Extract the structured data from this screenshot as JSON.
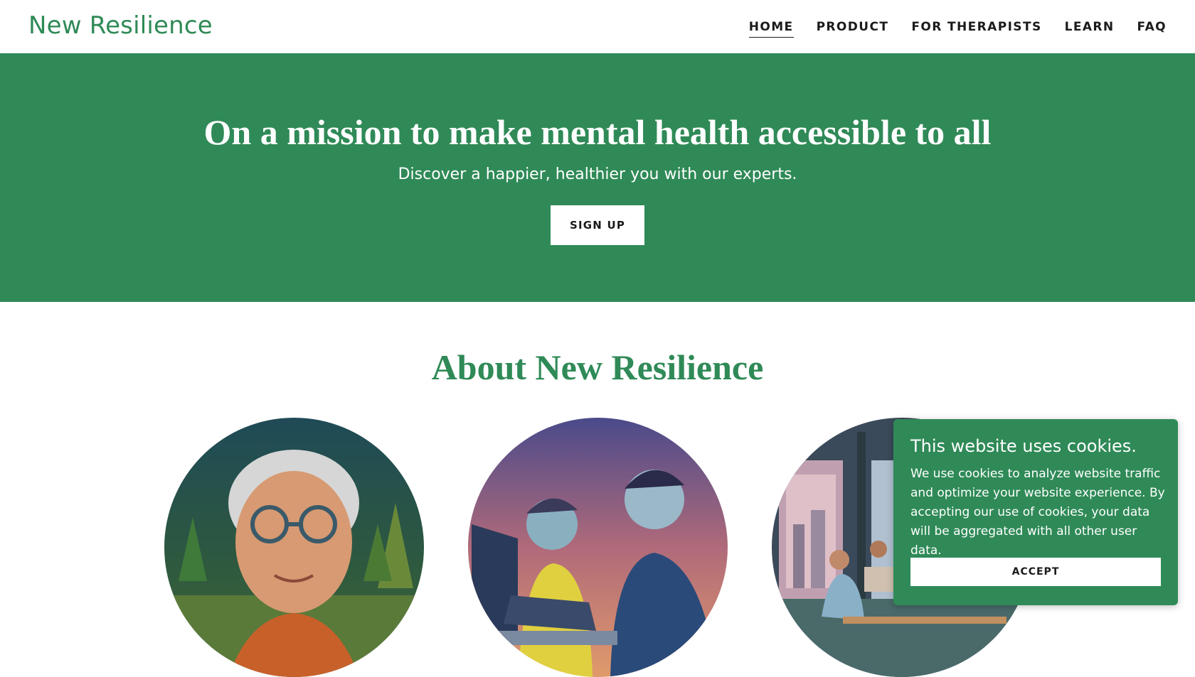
{
  "header": {
    "logo": "New Resilience",
    "nav": [
      {
        "label": "HOME",
        "active": true
      },
      {
        "label": "PRODUCT",
        "active": false
      },
      {
        "label": "FOR THERAPISTS",
        "active": false
      },
      {
        "label": "LEARN",
        "active": false
      },
      {
        "label": "FAQ",
        "active": false
      }
    ]
  },
  "hero": {
    "title": "On a mission to make mental health accessible to all",
    "subtitle": "Discover a happier, healthier you with our experts.",
    "cta_label": "SIGN UP"
  },
  "about": {
    "title": "About New Resilience",
    "images": [
      {
        "icon": "elderly-woman-portrait-image"
      },
      {
        "icon": "friends-at-laptop-image"
      },
      {
        "icon": "office-workspace-image"
      }
    ]
  },
  "cookie_banner": {
    "title": "This website uses cookies.",
    "text": "We use cookies to analyze website traffic and optimize your website experience. By accepting our use of cookies, your data will be aggregated with all other user data.",
    "accept_label": "ACCEPT"
  },
  "colors": {
    "brand_green": "#2f8a57",
    "text_dark": "#1b1b1b",
    "white": "#ffffff"
  }
}
